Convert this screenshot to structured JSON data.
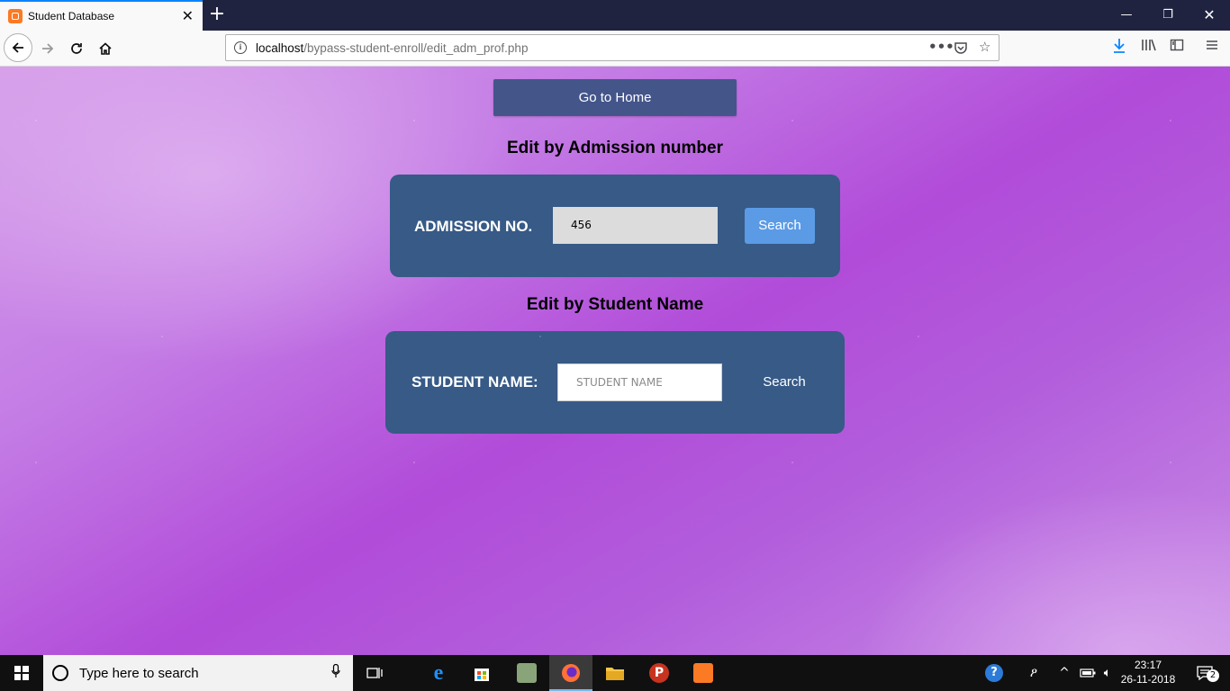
{
  "browser": {
    "tab_title": "Student Database",
    "tab_close": "✕",
    "new_tab": "+",
    "url_host": "localhost",
    "url_path": "/bypass-student-enroll/edit_adm_prof.php",
    "window_controls": [
      "—",
      "❐",
      "✕"
    ]
  },
  "page": {
    "home_button": "Go to Home",
    "admission_section": {
      "title": "Edit by Admission number",
      "label": "ADMISSION NO.",
      "input_value": "456",
      "search_button": "Search"
    },
    "name_section": {
      "title": "Edit by Student Name",
      "label": "STUDENT NAME:",
      "input_placeholder": "STUDENT NAME",
      "search_button": "Search"
    }
  },
  "taskbar": {
    "search_placeholder": "Type here to search",
    "time": "23:17",
    "date": "26-11-2018",
    "notification_count": "2"
  },
  "colors": {
    "card_bg": "#375a87",
    "home_btn_bg": "#44558a",
    "search_btn_bg": "#5b9be6",
    "input_bg_filled": "#dcdcdc",
    "accent_tab": "#0a84ff"
  }
}
